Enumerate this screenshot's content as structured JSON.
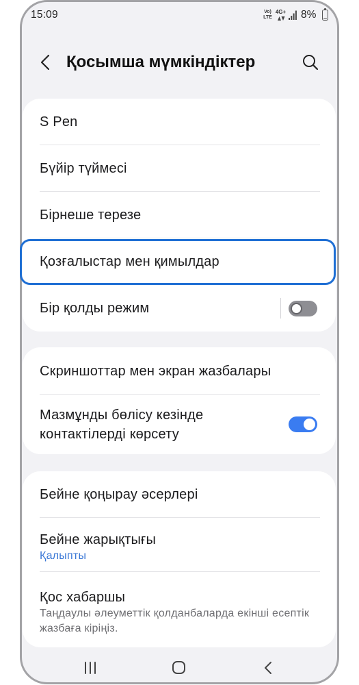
{
  "status_bar": {
    "time": "15:09",
    "volte_top": "Vo)",
    "volte_bottom": "LTE",
    "network_type": "4G+",
    "battery_text": "8%",
    "battery_level": 8
  },
  "header": {
    "title": "Қосымша мүмкіндіктер",
    "back_icon": "chevron-left-icon",
    "search_icon": "search-icon"
  },
  "groups": [
    {
      "items": [
        {
          "label": "S Pen"
        },
        {
          "label": "Бүйір түймесі"
        },
        {
          "label": "Бірнеше терезе"
        },
        {
          "label": "Қозғалыстар мен қимылдар",
          "highlighted": true
        },
        {
          "label": "Бір қолды режим",
          "toggle": false
        }
      ]
    },
    {
      "items": [
        {
          "label": "Скриншоттар мен экран жазбалары"
        },
        {
          "label": "Мазмұнды бөлісу кезінде контактілерді көрсету",
          "toggle": true
        }
      ]
    },
    {
      "items": [
        {
          "label": "Бейне қоңырау әсерлері"
        },
        {
          "label": "Бейне жарықтығы",
          "subtitle": "Қалыпты"
        },
        {
          "label": "Қос хабаршы",
          "subtitle": "Таңдаулы әлеуметтік қолданбаларда екінші есептік жазбаға кіріңіз."
        }
      ]
    }
  ],
  "nav_bar": {
    "recents_icon": "recents-icon",
    "home_icon": "home-icon",
    "back_icon": "back-icon"
  },
  "colors": {
    "screen_background": "#f2f2f5",
    "card_background": "#ffffff",
    "focus_highlight": "#1f6fd4",
    "toggle_on": "#3a7cf1",
    "toggle_off": "#8e8e93",
    "subtitle_accent": "#3b78d6",
    "subtitle_text": "#6e6e72"
  }
}
